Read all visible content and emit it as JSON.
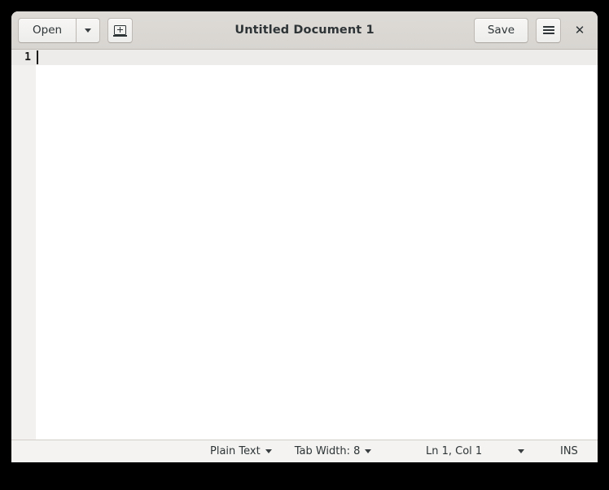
{
  "window": {
    "title": "Untitled Document 1"
  },
  "headerbar": {
    "open_label": "Open",
    "open_dropdown_icon": "chevron-down-icon",
    "new_document_icon": "new-document-icon",
    "save_label": "Save",
    "menu_icon": "hamburger-menu-icon",
    "close_label": "✕"
  },
  "editor": {
    "line_numbers": [
      "1"
    ],
    "content": ""
  },
  "statusbar": {
    "language_label": "Plain Text",
    "language_dropdown_icon": "chevron-down-icon",
    "tab_width_label": "Tab Width: 8",
    "tab_width_dropdown_icon": "chevron-down-icon",
    "position_label": "Ln 1, Col 1",
    "position_dropdown_icon": "chevron-down-icon",
    "insert_mode_label": "INS"
  },
  "colors": {
    "headerbar_bg": "#dcd9d5",
    "button_bg": "#f2f1ef",
    "text_primary": "#2e3436",
    "editor_bg": "#ffffff",
    "gutter_bg": "#f2f1f0",
    "current_line_bg": "#eeecea",
    "statusbar_bg": "#f4f3f1",
    "desktop_bg": "#000000"
  }
}
